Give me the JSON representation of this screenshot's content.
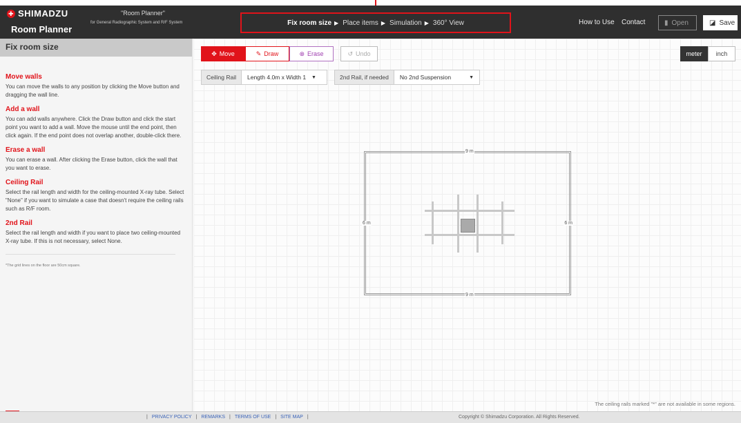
{
  "header": {
    "brand_name": "SHIMADZU",
    "app_name": "Room Planner",
    "title_quote": "\"Room Planner\"",
    "subtitle": "for General Radiographic System and R/F System",
    "steps": [
      {
        "label": "Fix room size",
        "active": true
      },
      {
        "label": "Place items",
        "active": false
      },
      {
        "label": "Simulation",
        "active": false
      },
      {
        "label": "360° View",
        "active": false
      }
    ],
    "how_to_use": "How to Use",
    "contact": "Contact",
    "open_label": "Open",
    "save_label": "Save"
  },
  "sidebar": {
    "heading": "Fix room size",
    "sections": [
      {
        "title": "Move walls",
        "text": "You can move the walls to any position by clicking the Move button and dragging the wall line."
      },
      {
        "title": "Add a wall",
        "text": "You can add walls anywhere. Click the Draw button and click the start point you want to add a wall. Move the mouse until the end point, then click again. If the end point does not overlap another, double-click there."
      },
      {
        "title": "Erase a wall",
        "text": "You can erase a wall. After clicking the Erase button, click the wall that you want to erase."
      },
      {
        "title": "Ceiling Rail",
        "text": "Select the rail length and width for the ceiling-mounted X-ray tube. Select \"None\" if you want to simulate a case that doesn't require the ceiling rails such as R/F room."
      },
      {
        "title": "2nd Rail",
        "text": "Select the rail length and width if you want to place two ceiling-mounted X-ray tube. If this is not necessary, select None."
      }
    ],
    "note": "*The grid lines on the floor are 50cm square."
  },
  "toolbar": {
    "move": "Move",
    "draw": "Draw",
    "erase": "Erase",
    "undo": "Undo",
    "unit_meter": "meter",
    "unit_inch": "inch",
    "ceiling_rail_label": "Ceiling Rail",
    "ceiling_rail_value": "Length 4.0m x Width 1",
    "second_rail_label": "2nd Rail, if needed",
    "second_rail_value": "No 2nd Suspension"
  },
  "room": {
    "top": "9 m",
    "bottom": "9 m",
    "left": "6 m",
    "right": "6 m"
  },
  "region_note": "The ceiling rails marked \"*\" are not available in some regions.",
  "footer": {
    "links": [
      "PRIVACY POLICY",
      "REMARKS",
      "TERMS OF USE",
      "SITE MAP"
    ],
    "copyright": "Copyright © Shimadzu Corporation. All Rights Reserved."
  }
}
